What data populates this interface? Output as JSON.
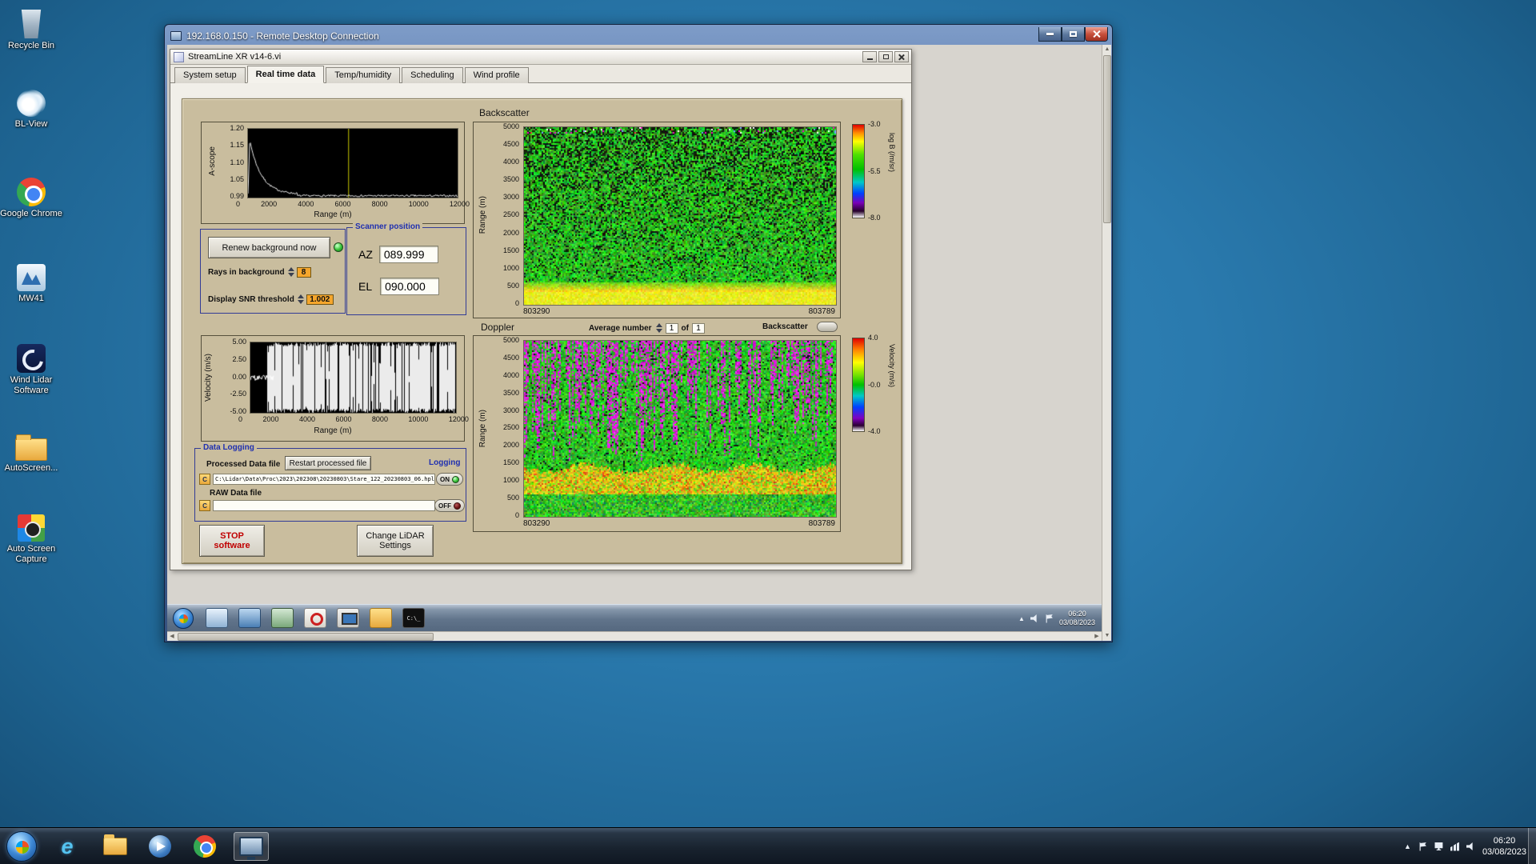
{
  "desktop": {
    "icons": [
      {
        "label": "Recycle Bin",
        "icon": "recycle-bin-icon"
      },
      {
        "label": "BL-View",
        "icon": "bl-view-icon"
      },
      {
        "label": "Google Chrome",
        "icon": "chrome-icon"
      },
      {
        "label": "MW41",
        "icon": "mw41-icon"
      },
      {
        "label": "Wind Lidar Software",
        "icon": "wind-lidar-icon"
      },
      {
        "label": "AutoScreen...",
        "icon": "folder-icon"
      },
      {
        "label": "Auto Screen Capture",
        "icon": "auto-screen-capture-icon"
      }
    ]
  },
  "rdp": {
    "title": "192.168.0.150 - Remote Desktop Connection"
  },
  "app": {
    "title": "StreamLine XR v14-6.vi",
    "tabs": [
      {
        "label": "System setup"
      },
      {
        "label": "Real time data"
      },
      {
        "label": "Temp/humidity"
      },
      {
        "label": "Scheduling"
      },
      {
        "label": "Wind profile"
      }
    ],
    "backscatter_heading": "Backscatter",
    "doppler_heading": "Doppler"
  },
  "ascope": {
    "ylabel": "A-scope",
    "xlabel": "Range (m)",
    "yticks": [
      "1.20",
      "1.15",
      "1.10",
      "1.05",
      "0.99"
    ],
    "xticks": [
      "0",
      "2000",
      "4000",
      "6000",
      "8000",
      "10000",
      "12000"
    ]
  },
  "velocity": {
    "ylabel": "Velocity (m/s)",
    "xlabel": "Range (m)",
    "yticks": [
      "5.00",
      "2.50",
      "0.00",
      "-2.50",
      "-5.00"
    ],
    "xticks": [
      "0",
      "2000",
      "4000",
      "6000",
      "8000",
      "10000",
      "12000"
    ]
  },
  "backscatter_map": {
    "ylabel": "Range (m)",
    "yticks": [
      "5000",
      "4500",
      "4000",
      "3500",
      "3000",
      "2500",
      "2000",
      "1500",
      "1000",
      "500",
      "0"
    ],
    "x_start": "803290",
    "x_end": "803789",
    "colorbar": {
      "ticks": [
        "-3.0",
        "-5.5",
        "-8.0"
      ],
      "label": "log B (/m/sr)"
    }
  },
  "doppler_map": {
    "ylabel": "Range (m)",
    "yticks": [
      "5000",
      "4500",
      "4000",
      "3500",
      "3000",
      "2500",
      "2000",
      "1500",
      "1000",
      "500",
      "0"
    ],
    "x_start": "803290",
    "x_end": "803789",
    "colorbar": {
      "ticks": [
        "4.0",
        "-0.0",
        "-4.0"
      ],
      "label": "Velocity (m/s)"
    }
  },
  "controls": {
    "renew_button": "Renew background now",
    "rays_label": "Rays in background",
    "rays_value": "8",
    "snr_label": "Display SNR threshold",
    "snr_value": "1.002",
    "scanner_title": "Scanner position",
    "az_label": "AZ",
    "az_value": "089.999",
    "el_label": "EL",
    "el_value": "090.000",
    "average_label": "Average number",
    "average_value": "1",
    "of_label": "of",
    "average_count": "1",
    "backscatter_toggle_label": "Backscatter"
  },
  "logging": {
    "title": "Data Logging",
    "processed_label": "Processed Data file",
    "restart_button": "Restart processed file",
    "logging_label": "Logging",
    "drive_letter": "C",
    "processed_path": "C:\\Lidar\\Data\\Proc\\2023\\202308\\20230803\\Stare_122_20230803_06.hpl",
    "processed_state": "ON",
    "raw_label": "RAW Data file",
    "raw_path": "",
    "raw_state": "OFF"
  },
  "actions": {
    "stop_line1": "STOP",
    "stop_line2": "software",
    "change_line1": "Change LiDAR",
    "change_line2": "Settings"
  },
  "remote_taskbar": {
    "time": "06:20",
    "date": "03/08/2023",
    "cmd_icon_text": "C:\\_"
  },
  "taskbar": {
    "time": "06:20",
    "date": "03/08/2023"
  }
}
